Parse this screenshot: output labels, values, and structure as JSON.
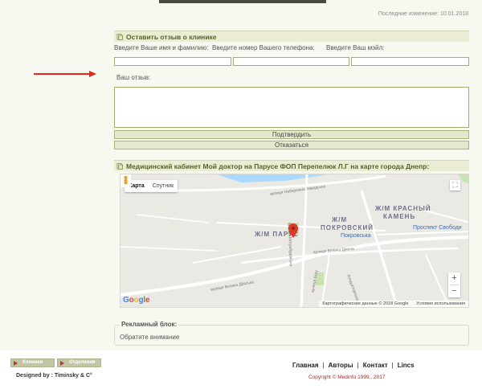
{
  "page": {
    "last_change": "Последние изменение: 10.01.2018"
  },
  "review_form": {
    "title": "Оставить отзыв о клинике",
    "name_label": "Введите Ваше имя и фамилию:",
    "phone_label": "Введите номер Вашего телефона:",
    "email_label": "Введите Ваш мэйл:",
    "name_value": "",
    "phone_value": "",
    "email_value": "",
    "review_label": "Ваш отзыв:",
    "review_value": "",
    "submit_label": "Подтвердить",
    "cancel_label": "Отказаться"
  },
  "map_section": {
    "title": "Медицинский кабинет Мой доктор на Парусе ФОП Перепелюк Л.Г на карте города Днепр:",
    "map_type_map": "Карта",
    "map_type_satellite": "Спутник",
    "district_1": "Ж/М КРАСНЫЙ",
    "district_1b": "КАМЕНЬ",
    "district_2": "Ж/М",
    "district_2b": "ПОКРОВСКИЙ",
    "district_3": "Ж/М ПАРУС",
    "street_1": "вулиця Набережна Заводська",
    "street_2": "вулиця Метробудівська",
    "street_3": "вулиця Велика Дівоча",
    "street_4": "вулиця Велика Діївська",
    "street_5": "вулиця Богу",
    "street_6": "Кондукторська",
    "poi_1": "Покровська",
    "poi_2": "Проспект Свободи",
    "zoom_in": "+",
    "zoom_out": "−",
    "attribution": "Картографические данные © 2018 Google",
    "terms": "Условия использования",
    "google_logo": "Google"
  },
  "ad_block": {
    "title": "Рекламный блок:",
    "text": "Обратите внимание"
  },
  "footer": {
    "btn_clinics": "Клиники",
    "btn_departments": "Отделения",
    "designed_by": "Designed by : Timinsky & C°",
    "link_home": "Главная",
    "link_authors": "Авторы",
    "link_contact": "Контакт",
    "link_lincs": "Lincs",
    "separator": "|",
    "copyright": "Copyright © Medinfo 1999...2017"
  },
  "colors": {
    "accent_arrow": "#e8261c",
    "marker": "#d93a2b",
    "section_title": "#54632a"
  }
}
